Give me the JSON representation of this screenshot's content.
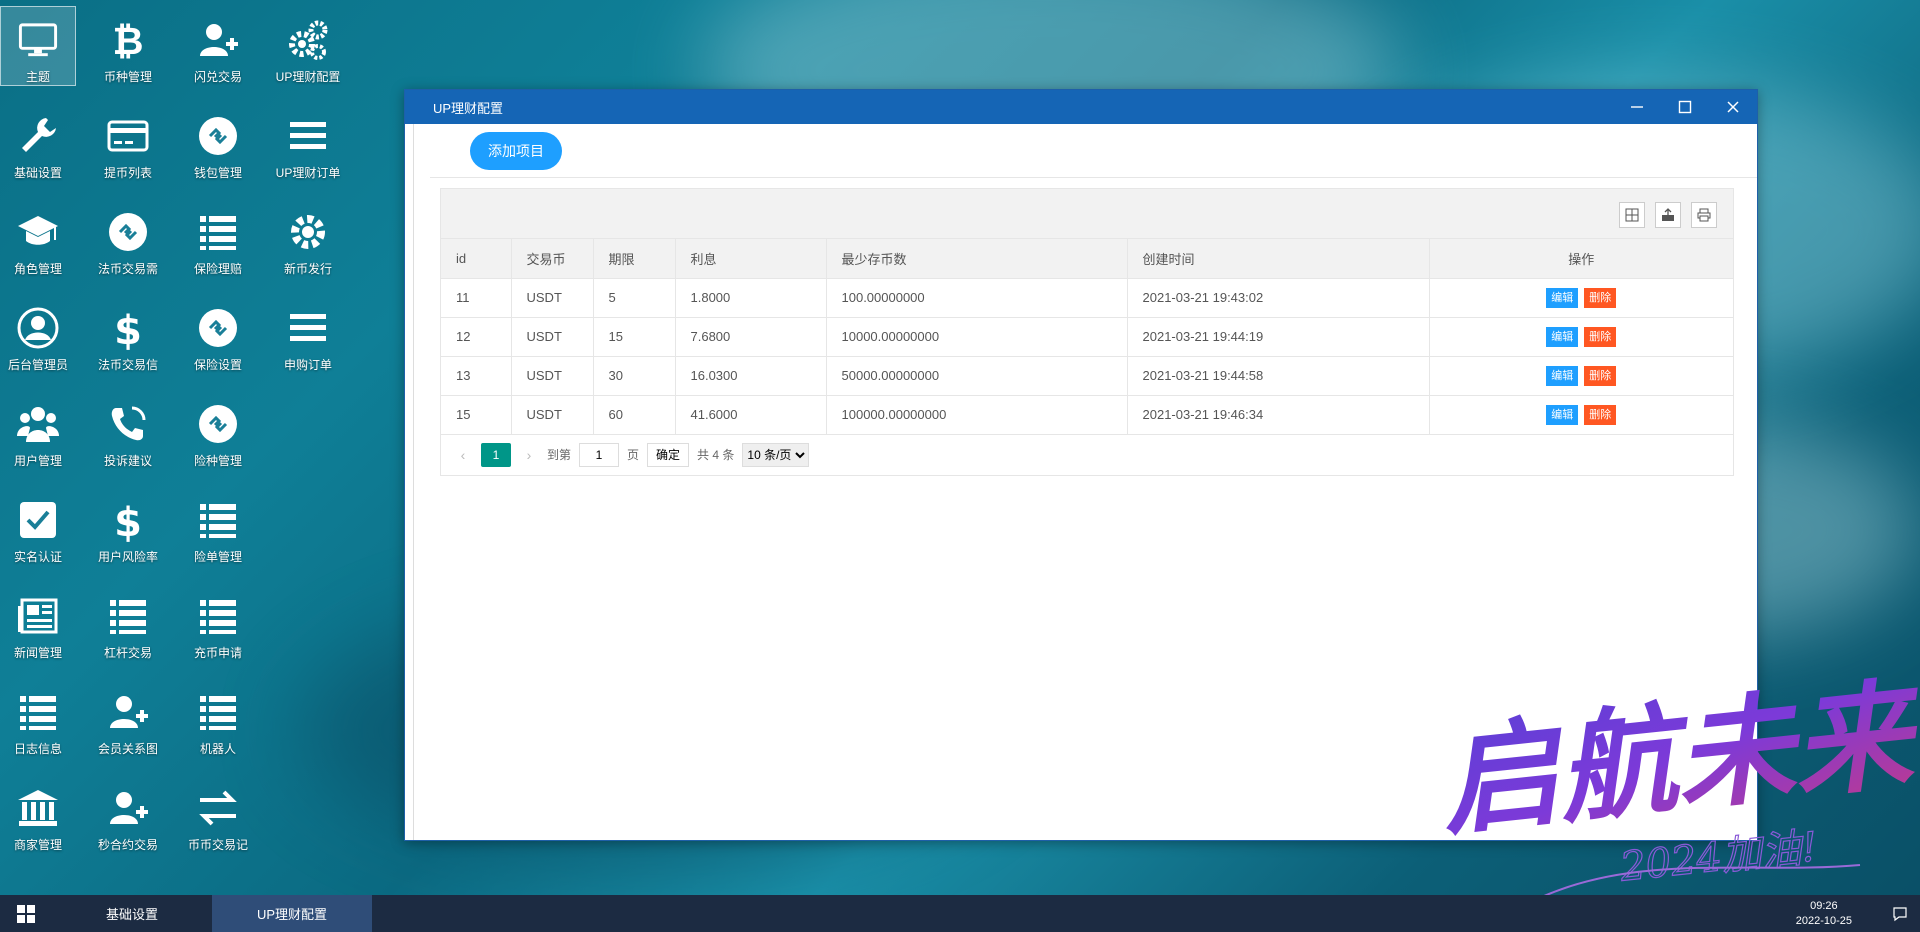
{
  "desktop": {
    "icons": [
      {
        "label": "主题",
        "icon": "monitor-icon"
      },
      {
        "label": "币种管理",
        "icon": "bitcoin-icon"
      },
      {
        "label": "闪兑交易",
        "icon": "user-plus-icon"
      },
      {
        "label": "UP理财配置",
        "icon": "gears-icon"
      },
      {
        "label": "基础设置",
        "icon": "wrench-icon"
      },
      {
        "label": "提币列表",
        "icon": "credit-card-icon"
      },
      {
        "label": "钱包管理",
        "icon": "link-circle-icon"
      },
      {
        "label": "UP理财订单",
        "icon": "menu-icon"
      },
      {
        "label": "角色管理",
        "icon": "graduation-cap-icon"
      },
      {
        "label": "法币交易需",
        "icon": "link-circle-icon"
      },
      {
        "label": "保险理赔",
        "icon": "list-icon"
      },
      {
        "label": "新币发行",
        "icon": "gear-icon"
      },
      {
        "label": "后台管理员",
        "icon": "user-circle-icon"
      },
      {
        "label": "法币交易信",
        "icon": "dollar-icon"
      },
      {
        "label": "保险设置",
        "icon": "link-circle-icon"
      },
      {
        "label": "申购订单",
        "icon": "menu-icon"
      },
      {
        "label": "用户管理",
        "icon": "users-icon"
      },
      {
        "label": "投诉建议",
        "icon": "phone-icon"
      },
      {
        "label": "险种管理",
        "icon": "link-circle-icon"
      },
      {
        "label": "实名认证",
        "icon": "check-square-icon"
      },
      {
        "label": "用户风险率",
        "icon": "dollar-icon"
      },
      {
        "label": "险单管理",
        "icon": "list-icon"
      },
      {
        "label": "新闻管理",
        "icon": "newspaper-icon"
      },
      {
        "label": "杠杆交易",
        "icon": "list-icon"
      },
      {
        "label": "充币申请",
        "icon": "list-icon"
      },
      {
        "label": "日志信息",
        "icon": "list-icon"
      },
      {
        "label": "会员关系图",
        "icon": "user-plus-icon"
      },
      {
        "label": "机器人",
        "icon": "list-icon"
      },
      {
        "label": "商家管理",
        "icon": "bank-icon"
      },
      {
        "label": "秒合约交易",
        "icon": "user-plus-icon"
      },
      {
        "label": "币币交易记",
        "icon": "exchange-icon"
      }
    ]
  },
  "window": {
    "title": "UP理财配置",
    "add_button": "添加项目",
    "table": {
      "headers": [
        "id",
        "交易币",
        "期限",
        "利息",
        "最少存币数",
        "创建时间",
        "操作"
      ],
      "rows": [
        [
          "11",
          "USDT",
          "5",
          "1.8000",
          "100.00000000",
          "2021-03-21 19:43:02"
        ],
        [
          "12",
          "USDT",
          "15",
          "7.6800",
          "10000.00000000",
          "2021-03-21 19:44:19"
        ],
        [
          "13",
          "USDT",
          "30",
          "16.0300",
          "50000.00000000",
          "2021-03-21 19:44:58"
        ],
        [
          "15",
          "USDT",
          "60",
          "41.6000",
          "100000.00000000",
          "2021-03-21 19:46:34"
        ]
      ],
      "edit_label": "编辑",
      "delete_label": "删除"
    },
    "pager": {
      "current": "1",
      "goto_label": "到第",
      "goto_value": "1",
      "page_unit": "页",
      "confirm": "确定",
      "total": "共 4 条",
      "page_size": "10 条/页"
    }
  },
  "watermark": {
    "main": "启航未来",
    "sub": "2024加油!"
  },
  "taskbar": {
    "tasks": [
      "基础设置",
      "UP理财配置"
    ],
    "time": "09:26",
    "date": "2022-10-25"
  }
}
